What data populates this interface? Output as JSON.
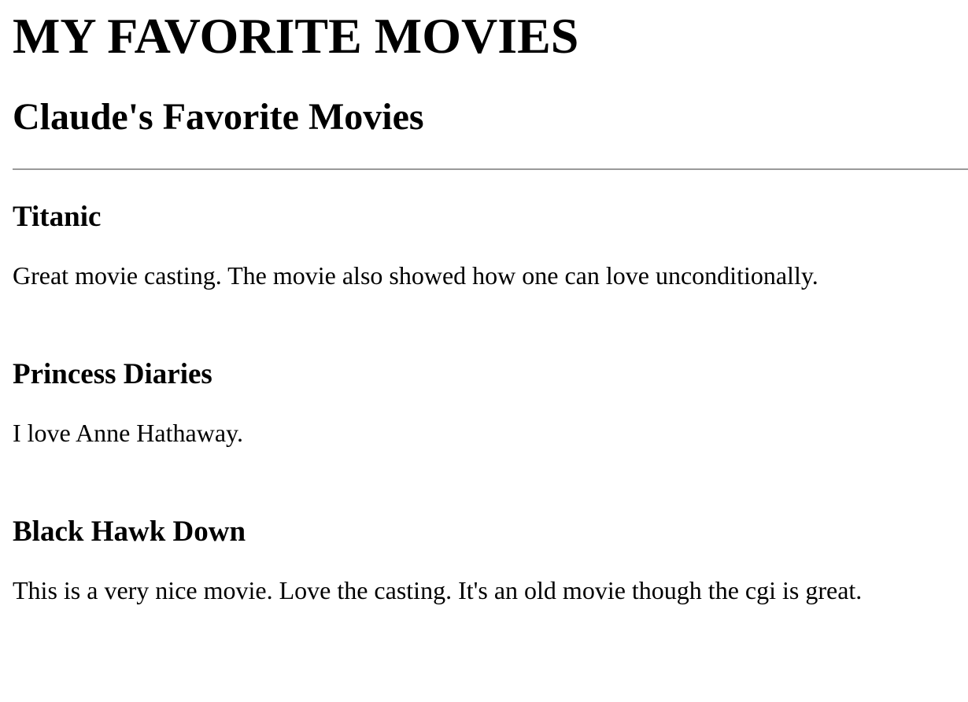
{
  "page": {
    "title": "MY FAVORITE MOVIES",
    "subtitle": "Claude's Favorite Movies"
  },
  "movies": [
    {
      "title": "Titanic",
      "review": "Great movie casting. The movie also showed how one can love unconditionally."
    },
    {
      "title": "Princess Diaries",
      "review": "I love Anne Hathaway."
    },
    {
      "title": "Black Hawk Down",
      "review": "This is a very nice movie. Love the casting. It's an old movie though the cgi is great."
    }
  ]
}
